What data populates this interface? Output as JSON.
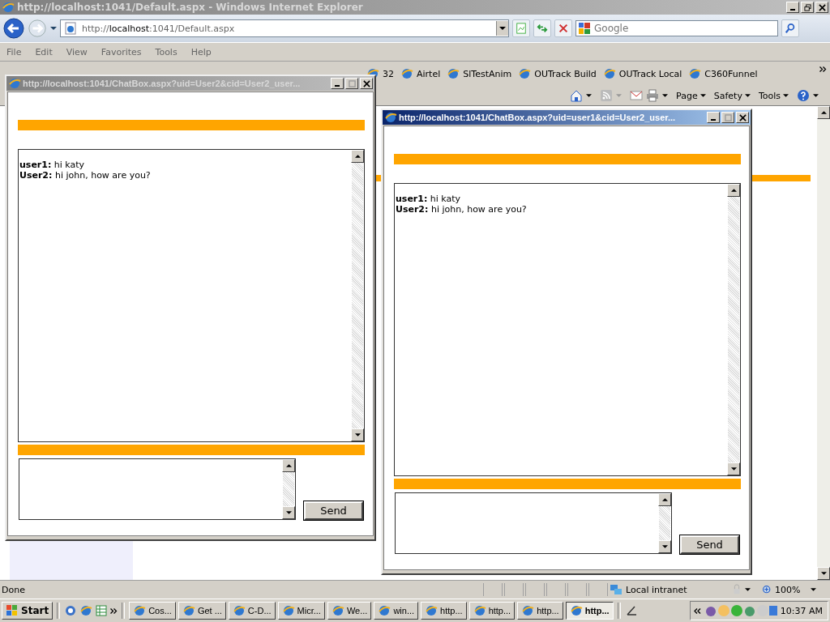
{
  "browser": {
    "title": "http://localhost:1041/Default.aspx - Windows Internet Explorer",
    "address": "http://**localhost**:1041/Default.aspx",
    "search_placeholder": "Google",
    "menu": [
      "File",
      "Edit",
      "View",
      "Favorites",
      "Tools",
      "Help"
    ],
    "favorites": [
      "32",
      "Airtel",
      "SlTestAnim",
      "OUTrack Build",
      "OUTrack Local",
      "C360Funnel"
    ],
    "commands": [
      "Page",
      "Safety",
      "Tools"
    ],
    "status": "Done",
    "zone": "Local intranet",
    "zoom": "100%"
  },
  "popups": [
    {
      "title": "http://localhost:1041/ChatBox.aspx?uid=User2&cid=User2_user...",
      "active": false,
      "messages": [
        {
          "sender": "user1:",
          "text": "hi katy"
        },
        {
          "sender": "User2:",
          "text": "hi john, how are you?"
        }
      ],
      "send_label": "Send"
    },
    {
      "title": "http://localhost:1041/ChatBox.aspx?uid=user1&cid=User2_user...",
      "active": true,
      "messages": [
        {
          "sender": "user1:",
          "text": "hi katy"
        },
        {
          "sender": "User2:",
          "text": "hi john, how are you?"
        }
      ],
      "send_label": "Send"
    }
  ],
  "taskbar": {
    "start": "Start",
    "tasks": [
      {
        "label": "Cos...",
        "selected": false
      },
      {
        "label": "Get ...",
        "selected": false
      },
      {
        "label": "C-D...",
        "selected": false
      },
      {
        "label": "Micr...",
        "selected": false
      },
      {
        "label": "We...",
        "selected": false
      },
      {
        "label": "win...",
        "selected": false
      },
      {
        "label": "http...",
        "selected": false
      },
      {
        "label": "http...",
        "selected": false
      },
      {
        "label": "http...",
        "selected": false
      },
      {
        "label": "http...",
        "selected": true
      }
    ],
    "clock": "10:37 AM"
  }
}
